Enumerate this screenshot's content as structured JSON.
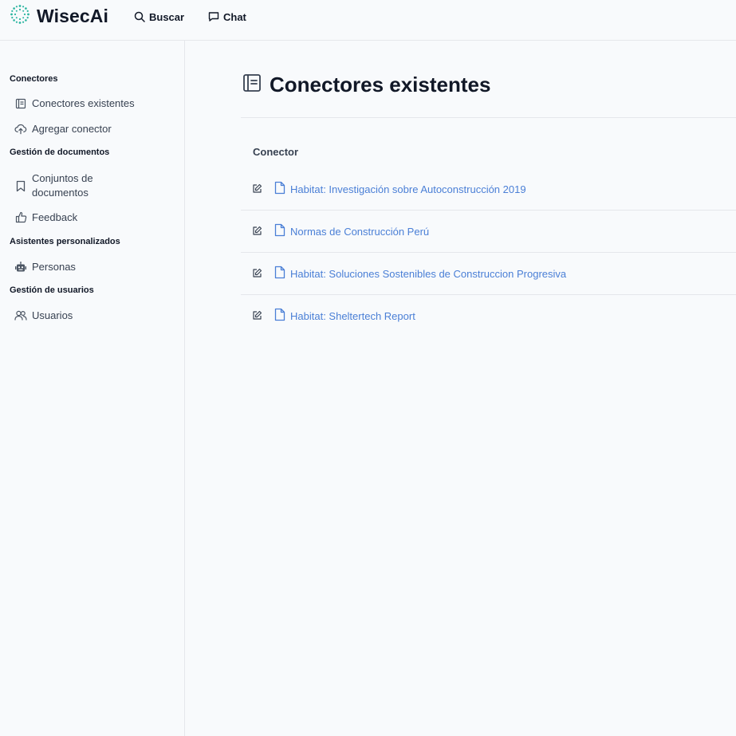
{
  "app": {
    "name": "WisecAi",
    "nav": [
      {
        "label": "Buscar",
        "icon": "search-icon"
      },
      {
        "label": "Chat",
        "icon": "chat-bubble-icon"
      }
    ]
  },
  "sidebar": {
    "sections": [
      {
        "title": "Conectores",
        "items": [
          {
            "label": "Conectores existentes",
            "icon": "notebook-icon"
          },
          {
            "label": "Agregar conector",
            "icon": "cloud-upload-icon"
          }
        ]
      },
      {
        "title": "Gestión de documentos",
        "items": [
          {
            "label": "Conjuntos de documentos",
            "icon": "bookmark-icon"
          },
          {
            "label": "Feedback",
            "icon": "thumbs-up-icon"
          }
        ]
      },
      {
        "title": "Asistentes personalizados",
        "items": [
          {
            "label": "Personas",
            "icon": "robot-icon"
          }
        ]
      },
      {
        "title": "Gestión de usuarios",
        "items": [
          {
            "label": "Usuarios",
            "icon": "users-icon"
          }
        ]
      }
    ]
  },
  "main": {
    "title": "Conectores existentes",
    "title_icon": "notebook-icon",
    "table": {
      "column": "Conector",
      "rows": [
        {
          "label": "Habitat: Investigación sobre Autoconstrucción 2019"
        },
        {
          "label": "Normas de Construcción Perú"
        },
        {
          "label": "Habitat: Soluciones Sostenibles de Construccion Progresiva"
        },
        {
          "label": "Habitat: Sheltertech Report"
        }
      ]
    }
  },
  "colors": {
    "accent": "#4a7fd6",
    "logo": "#2bb5a0",
    "background": "#f8fafc",
    "border": "#e5e7eb"
  }
}
